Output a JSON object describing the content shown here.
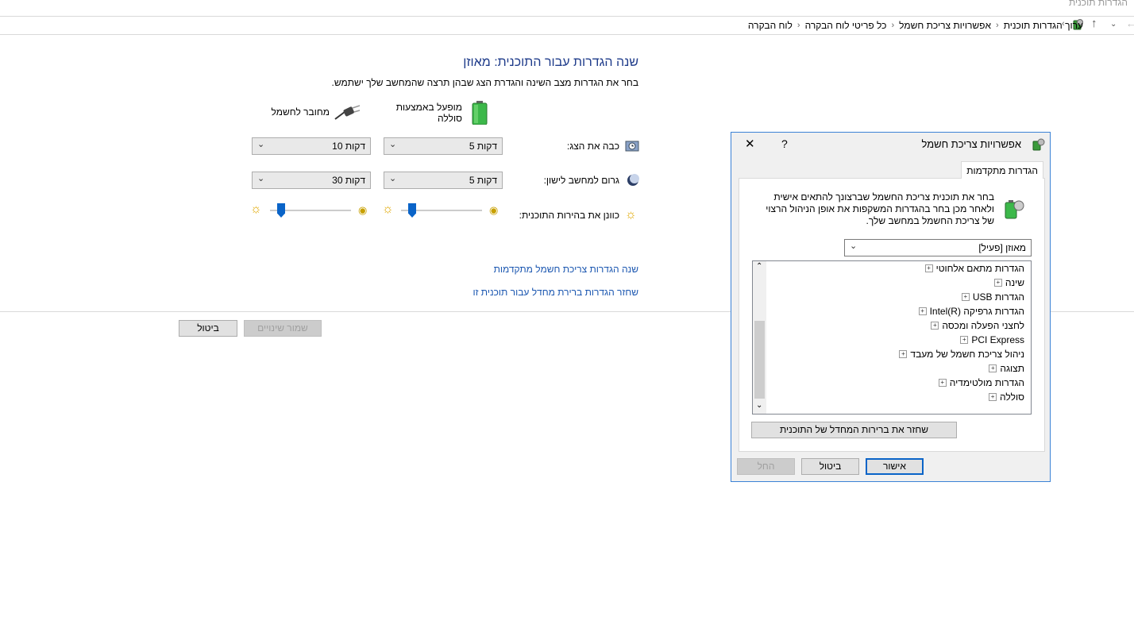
{
  "window": {
    "title": "הגדרות תוכנית"
  },
  "breadcrumb": {
    "items": [
      "לוח הבקרה",
      "כל פריטי לוח הבקרה",
      "אפשרויות צריכת חשמל",
      "ערוך הגדרות תוכנית"
    ]
  },
  "main": {
    "heading": "שנה הגדרות עבור התוכנית: מאוזן",
    "subtext": "בחר את הגדרות מצב השינה והגדרת הצג שבהן תרצה שהמחשב שלך ישתמש.",
    "battery_header": "מופעל באמצעות\nסוללה",
    "plugged_header": "מחובר לחשמל",
    "rows": {
      "display": {
        "label": "כבה את הצג:",
        "battery": "5 דקות",
        "plugged": "10 דקות"
      },
      "sleep": {
        "label": "גרום למחשב לישון:",
        "battery": "5 דקות",
        "plugged": "30 דקות"
      },
      "brightness": {
        "label": "כוונן את בהירות התוכנית:",
        "battery_level": 0.1,
        "plugged_level": 0.1
      }
    },
    "link_advanced": "שנה הגדרות צריכת חשמל מתקדמות",
    "link_restore": "שחזר הגדרות ברירת מחדל עבור תוכנית זו",
    "save_label": "שמור שינויים",
    "cancel_label": "ביטול"
  },
  "dialog": {
    "title": "אפשרויות צריכת חשמל",
    "help": "?",
    "close": "✕",
    "tab": "הגדרות מתקדמות",
    "description": "בחר את תוכנית צריכת החשמל שברצונך להתאים אישית ולאחר מכן בחר בהגדרות המשקפות את אופן הניהול הרצוי של צריכת החשמל במחשב שלך.",
    "plan_select": "מאוזן [פעיל]",
    "tree": [
      "הגדרות מתאם אלחוטי",
      "שינה",
      "הגדרות USB",
      "הגדרות גרפיקה Intel(R)",
      "לחצני הפעלה ומכסה",
      "PCI Express",
      "ניהול צריכת חשמל של מעבד",
      "תצוגה",
      "הגדרות מולטימדיה",
      "סוללה"
    ],
    "restore_button": "שחזר את ברירות המחדל של התוכנית",
    "ok": "אישור",
    "cancel": "ביטול",
    "apply": "החל"
  },
  "colors": {
    "accent": "#0a64c8",
    "link": "#1a56b0",
    "heading": "#1e3b8a"
  }
}
